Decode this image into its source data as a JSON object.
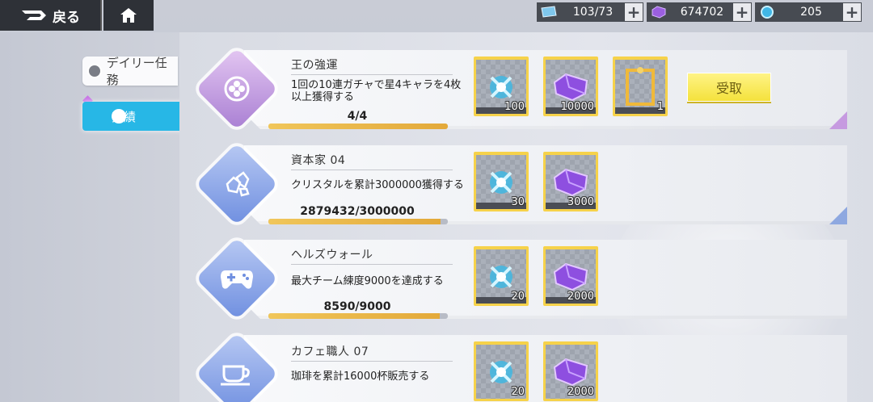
{
  "topbar": {
    "back_label": "戻る",
    "resources": [
      {
        "icon": "ticket-icon",
        "value": "103/73"
      },
      {
        "icon": "crystal-icon",
        "value": "674702"
      },
      {
        "icon": "orb-icon",
        "value": "205"
      }
    ],
    "plus": "+"
  },
  "sidebar": {
    "tabs": [
      {
        "label": "デイリー任務",
        "active": false
      },
      {
        "label": "実績",
        "active": true
      }
    ]
  },
  "achievements": [
    {
      "title": "王の強運",
      "description_lines": [
        "1回の10連ガチャで星4キャラを4枚",
        "以上獲得する"
      ],
      "progress_text": "4/4",
      "progress": 1.0,
      "badge_icon": "clover-icon",
      "rewards": [
        {
          "icon": "blue-orb-icon",
          "count": "100"
        },
        {
          "icon": "purple-crystal-icon",
          "count": "10000"
        },
        {
          "icon": "gold-frame-icon",
          "count": "1"
        }
      ],
      "claim_label": "受取"
    },
    {
      "title": "資本家 04",
      "description_lines": [
        "クリスタルを累計3000000獲得する"
      ],
      "progress_text": "2879432/3000000",
      "progress": 0.96,
      "badge_icon": "crystals-icon",
      "rewards": [
        {
          "icon": "blue-orb-icon",
          "count": "30"
        },
        {
          "icon": "purple-crystal-icon",
          "count": "3000"
        }
      ]
    },
    {
      "title": "ヘルズウォール",
      "description_lines": [
        "最大チーム練度9000を達成する"
      ],
      "progress_text": "8590/9000",
      "progress": 0.954,
      "badge_icon": "gamepad-icon",
      "rewards": [
        {
          "icon": "blue-orb-icon",
          "count": "20"
        },
        {
          "icon": "purple-crystal-icon",
          "count": "2000"
        }
      ]
    },
    {
      "title": "カフェ職人 07",
      "description_lines": [
        "珈琲を累計16000杯販売する"
      ],
      "badge_icon": "coffee-cup-icon",
      "rewards": [
        {
          "icon": "blue-orb-icon",
          "count": "20"
        },
        {
          "icon": "purple-crystal-icon",
          "count": "2000"
        }
      ]
    }
  ],
  "colors": {
    "accent_blue": "#27b7e6",
    "claim_yellow": "#f4e13a",
    "reward_frame": "#f6d24a",
    "progress_fill": "#e3a93a"
  }
}
